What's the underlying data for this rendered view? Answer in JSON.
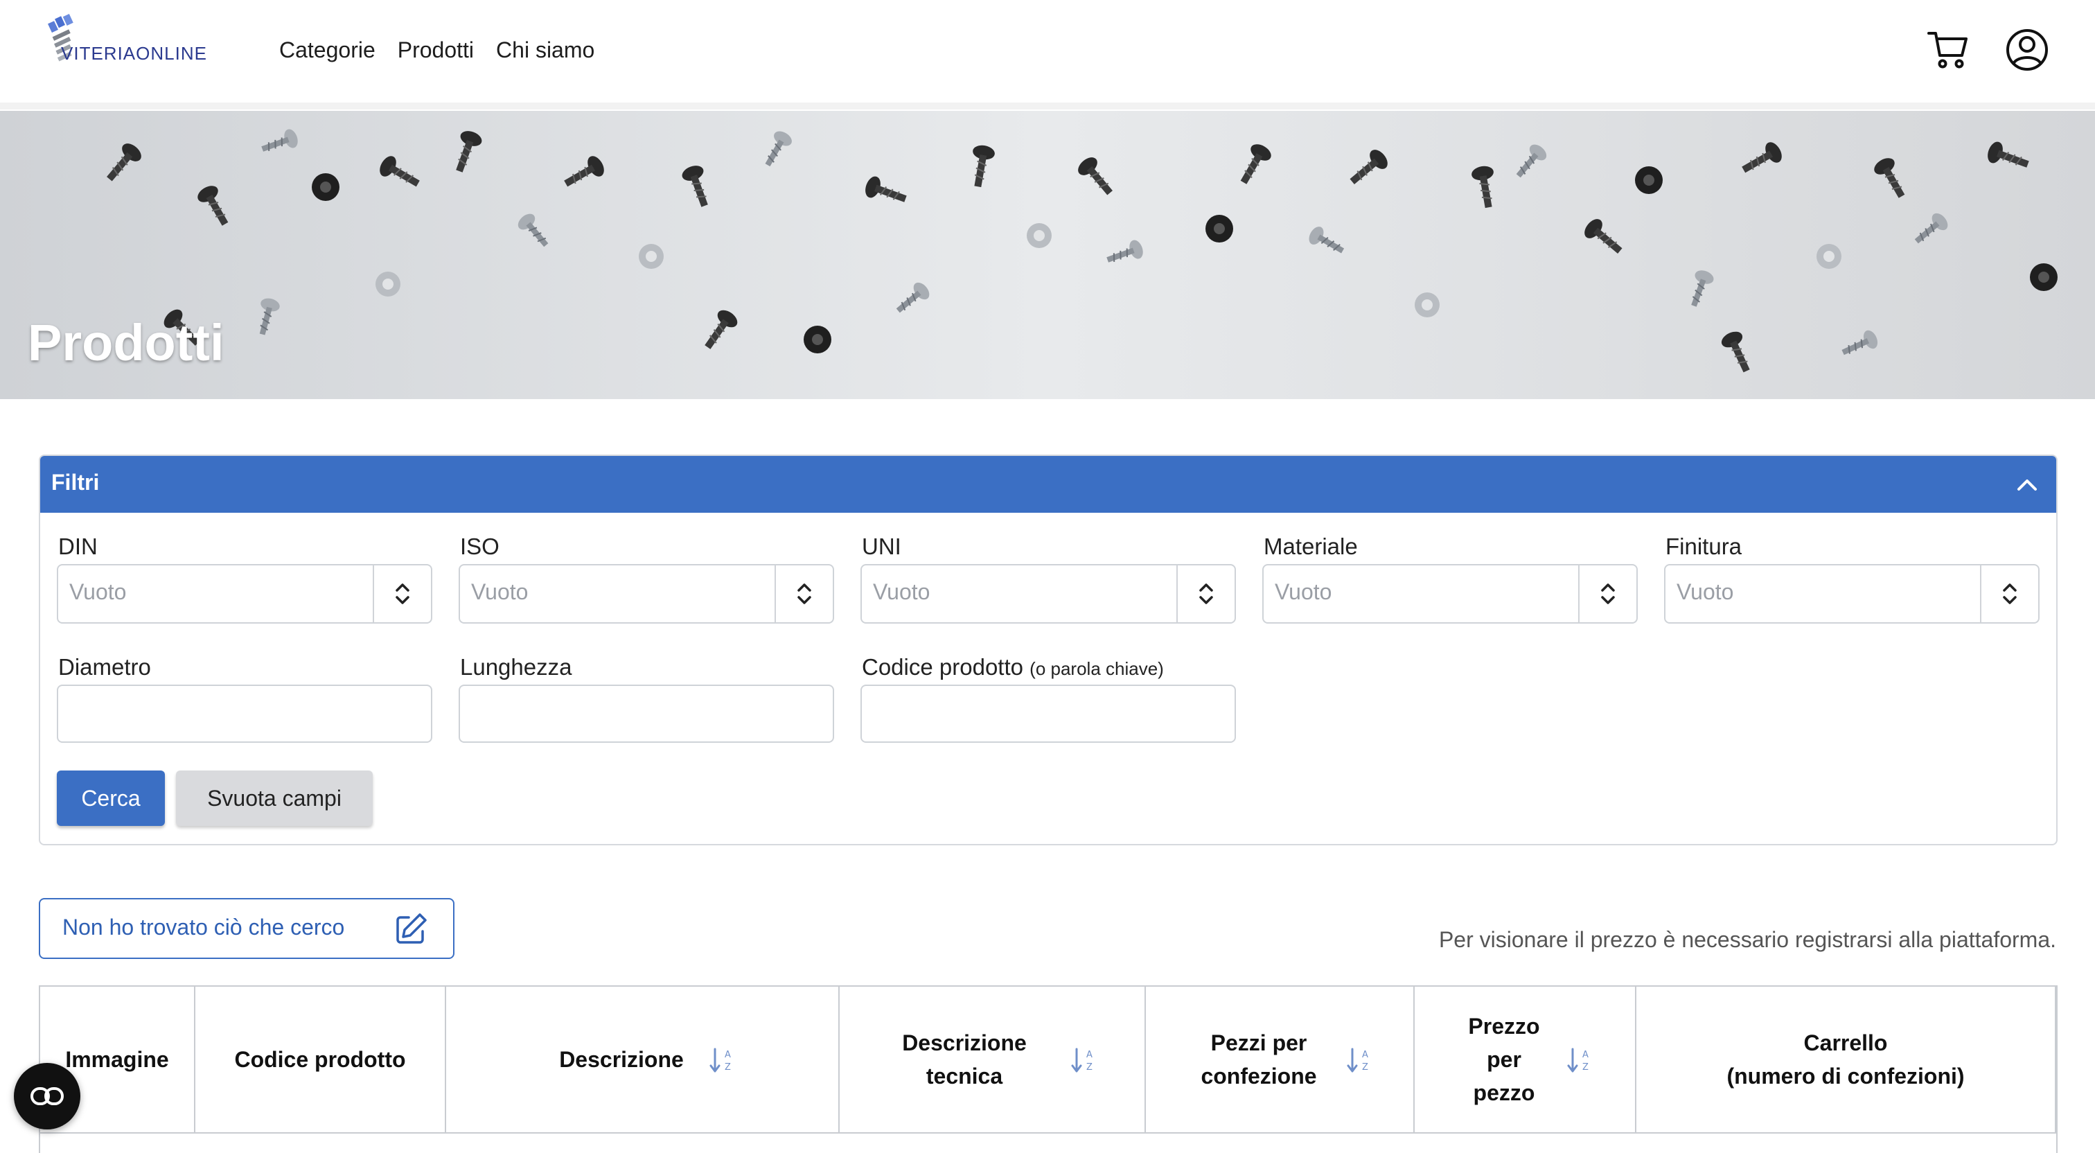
{
  "header": {
    "logo_text": "VITERIAONLINE",
    "nav": [
      {
        "label": "Categorie"
      },
      {
        "label": "Prodotti"
      },
      {
        "label": "Chi siamo"
      }
    ],
    "icons": [
      "cart-icon",
      "user-account-icon"
    ]
  },
  "hero": {
    "title": "Prodotti"
  },
  "filters": {
    "title": "Filtri",
    "fields": [
      {
        "label": "DIN",
        "placeholder": "Vuoto"
      },
      {
        "label": "ISO",
        "placeholder": "Vuoto"
      },
      {
        "label": "UNI",
        "placeholder": "Vuoto"
      },
      {
        "label": "Materiale",
        "placeholder": "Vuoto"
      },
      {
        "label": "Finitura",
        "placeholder": "Vuoto"
      }
    ],
    "text_fields": [
      {
        "label": "Diametro",
        "value": ""
      },
      {
        "label": "Lunghezza",
        "value": ""
      },
      {
        "label": "Codice prodotto",
        "hint": "(o parola chiave)",
        "value": ""
      }
    ],
    "search_label": "Cerca",
    "clear_label": "Svuota campi"
  },
  "request_button": {
    "label": "Non ho trovato ciò che cerco",
    "icon": "edit-icon"
  },
  "price_note": "Per visionare il prezzo è necessario registrarsi alla piattaforma.",
  "table": {
    "columns": [
      {
        "label": "Immagine"
      },
      {
        "label": "Codice prodotto"
      },
      {
        "label": "Descrizione"
      },
      {
        "label": "Descrizione tecnica"
      },
      {
        "label": "Pezzi per confezione"
      },
      {
        "label": "Prezzo per pezzo"
      },
      {
        "label": "Carrello (numero di confezioni)"
      }
    ],
    "header_lines": {
      "c3": [
        "Descrizione",
        "tecnica"
      ],
      "c4": [
        "Pezzi per",
        "confezione"
      ],
      "c5": [
        "Prezzo",
        "per",
        "pezzo"
      ],
      "c6": [
        "Carrello",
        "(numero di confezioni)"
      ]
    }
  },
  "colors": {
    "accent": "#3b6fc4",
    "brand": "#2b3a8f"
  }
}
